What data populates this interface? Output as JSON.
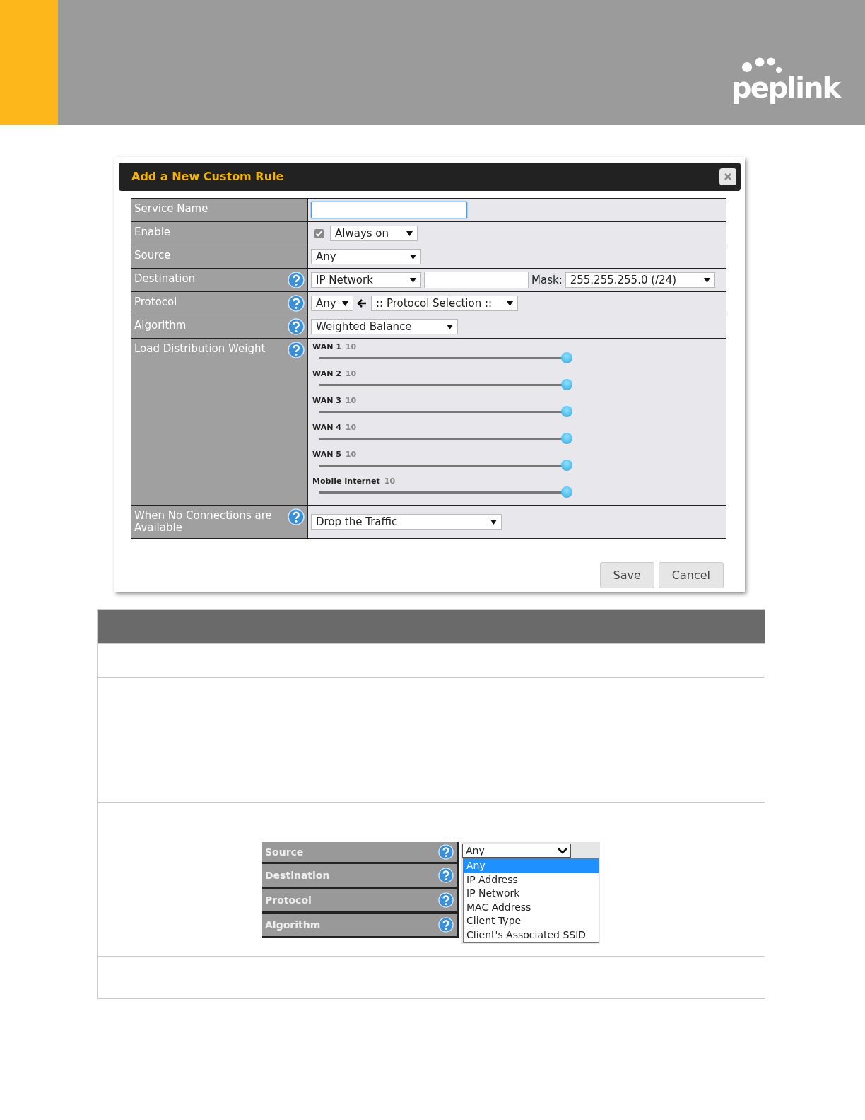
{
  "header": {
    "logo": "peplink"
  },
  "dialog": {
    "title": "Add a New Custom Rule",
    "fields": [
      {
        "kind": "text",
        "label": "Service Name",
        "help": false,
        "focused": true
      },
      {
        "kind": "enable",
        "label": "Enable",
        "help": false,
        "checked": true,
        "select": "Always on"
      },
      {
        "kind": "select",
        "label": "Source",
        "help": false,
        "select": "Any"
      },
      {
        "kind": "destination",
        "label": "Destination",
        "help": true,
        "select": "IP Network",
        "mask_label": "Mask:",
        "mask": "255.255.255.0 (/24)"
      },
      {
        "kind": "protocol",
        "label": "Protocol",
        "help": true,
        "select": "Any",
        "protocol_select": ":: Protocol Selection ::"
      },
      {
        "kind": "select",
        "label": "Algorithm",
        "help": true,
        "select": "Weighted Balance"
      },
      {
        "kind": "weights",
        "label": "Load Distribution Weight",
        "help": true,
        "sliders": [
          {
            "name": "WAN 1",
            "reading": "10",
            "level": 1
          },
          {
            "name": "WAN 2",
            "reading": "10",
            "level": 1
          },
          {
            "name": "WAN 3",
            "reading": "10",
            "level": 1
          },
          {
            "name": "WAN 4",
            "reading": "10",
            "level": 1
          },
          {
            "name": "WAN 5",
            "reading": "10",
            "level": 1
          },
          {
            "name": "Mobile Internet",
            "reading": "10",
            "level": 1
          }
        ]
      },
      {
        "kind": "select",
        "label": "When No Connections are Available",
        "help": true,
        "select": "Drop the Traffic"
      }
    ],
    "buttons": [
      "Save",
      "Cancel"
    ]
  },
  "screenshot": {
    "rows": [
      {
        "label": "Source"
      },
      {
        "label": "Destination"
      },
      {
        "label": "Protocol"
      },
      {
        "label": "Algorithm"
      }
    ],
    "select": "Any",
    "options": [
      {
        "label": "Any",
        "selected": true
      },
      {
        "label": "IP Address",
        "selected": false
      },
      {
        "label": "IP Network",
        "selected": false
      },
      {
        "label": "MAC Address",
        "selected": false
      },
      {
        "label": "Client Type",
        "selected": false
      },
      {
        "label": "Client's Associated SSID",
        "selected": false
      }
    ]
  }
}
